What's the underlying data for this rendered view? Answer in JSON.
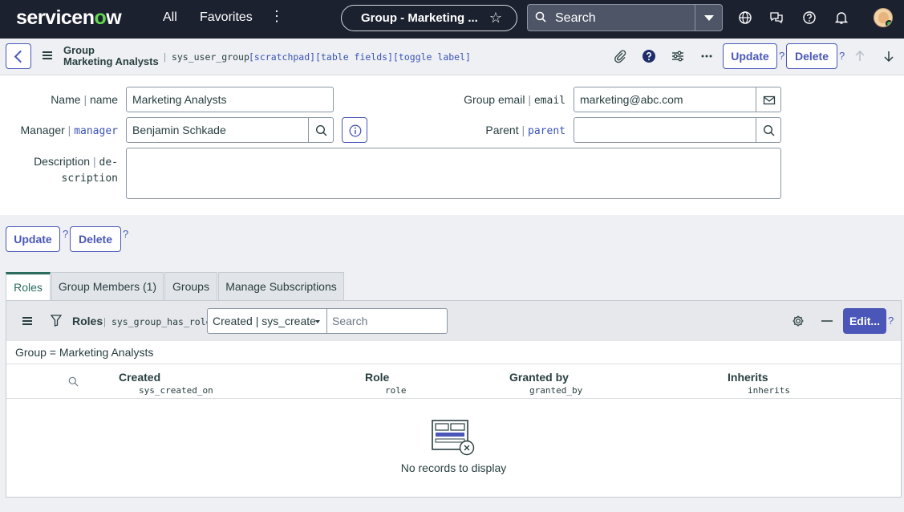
{
  "nav": {
    "logo_a": "servicen",
    "logo_o": "o",
    "logo_b": "w",
    "all": "All",
    "favorites": "Favorites",
    "title_tab": "Group - Marketing ...",
    "search_placeholder": "Search"
  },
  "header": {
    "title_line1": "Group",
    "title_line2": "Marketing Analysts",
    "sep": "|",
    "table_name": "sys_user_group",
    "links": "[scratchpad][table fields][toggle label]",
    "update_label": "Update",
    "delete_label": "Delete",
    "help": "?"
  },
  "form": {
    "name_label": "Name",
    "name_field": "name",
    "name_value": "Marketing Analysts",
    "manager_label": "Manager",
    "manager_field": "manager",
    "manager_value": "Benjamin Schkade",
    "description_label": "Description",
    "description_field_a": "de-",
    "description_field_b": "scription",
    "description_value": "",
    "email_label": "Group email",
    "email_field": "email",
    "email_value": "marketing@abc.com",
    "parent_label": "Parent",
    "parent_field": "parent",
    "parent_value": "",
    "sep": "|"
  },
  "actions": {
    "update_label": "Update",
    "delete_label": "Delete",
    "help": "?"
  },
  "tabs": [
    {
      "label": "Roles",
      "active": true
    },
    {
      "label": "Group Members (1)",
      "active": false
    },
    {
      "label": "Groups",
      "active": false
    },
    {
      "label": "Manage Subscriptions",
      "active": false
    }
  ],
  "related_list": {
    "title": "Roles",
    "sep": "|",
    "table_name": "sys_group_has_role",
    "filter_select": "Created | sys_create",
    "search_placeholder": "Search",
    "edit_label": "Edit...",
    "help": "?",
    "breadcrumb": "Group = Marketing Analysts",
    "columns": [
      {
        "title": "Created",
        "field": "sys_created_on"
      },
      {
        "title": "Role",
        "field": "role"
      },
      {
        "title": "Granted by",
        "field": "granted_by"
      },
      {
        "title": "Inherits",
        "field": "inherits"
      }
    ],
    "empty_message": "No records to display"
  },
  "colors": {
    "nav_bg": "#1c2130",
    "brand_green": "#62d84e",
    "primary": "#4a57b8",
    "active_tab": "#2b6c5f"
  }
}
